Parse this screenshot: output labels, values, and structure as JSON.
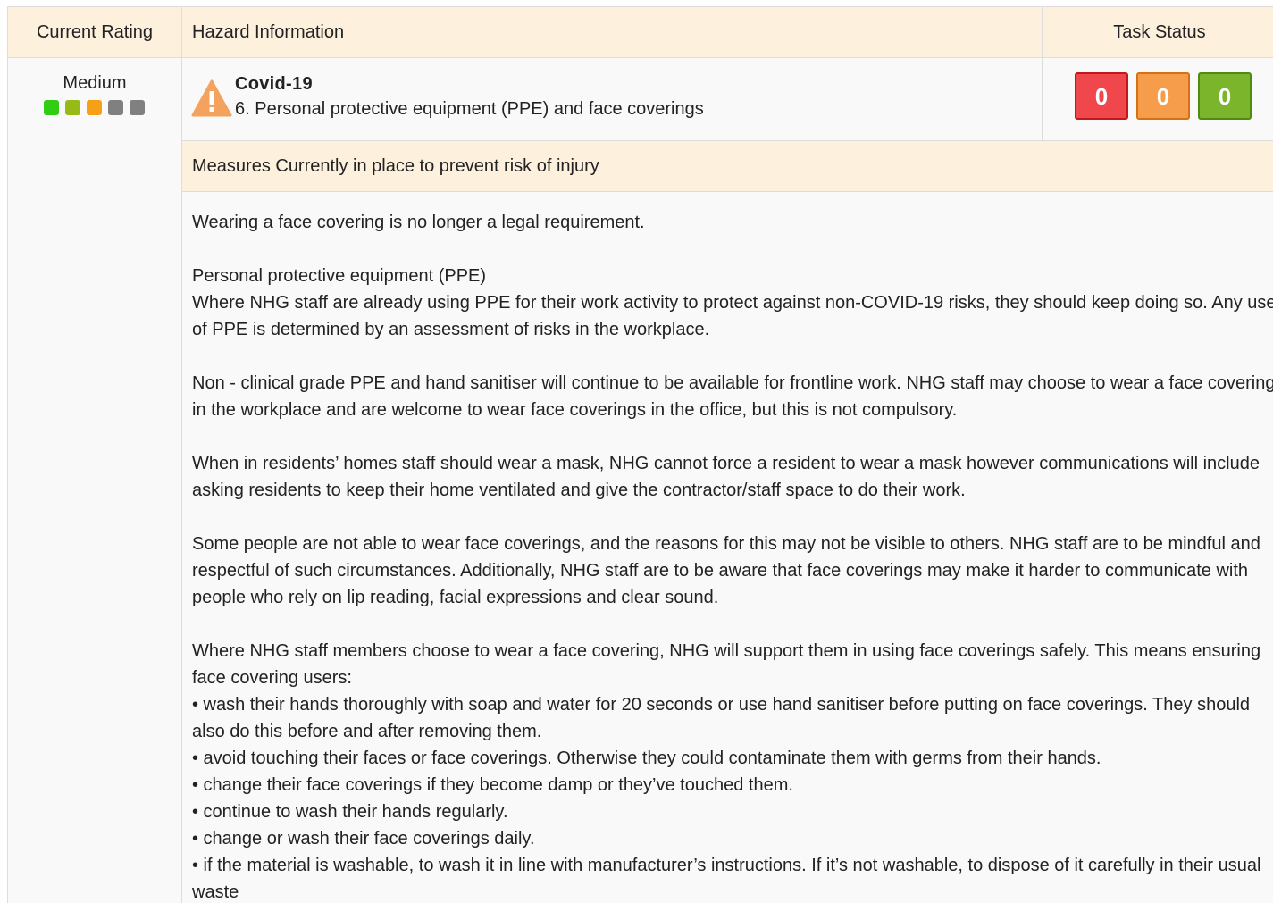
{
  "table": {
    "headers": {
      "current_rating": "Current Rating",
      "hazard_information": "Hazard Information",
      "task_status": "Task Status"
    }
  },
  "rating": {
    "label": "Medium",
    "dots": [
      {
        "color": "#33cc14"
      },
      {
        "color": "#96bb16"
      },
      {
        "color": "#f5a017"
      },
      {
        "color": "#808080"
      },
      {
        "color": "#808080"
      }
    ]
  },
  "hazard": {
    "icon": "warning-triangle-icon",
    "title": "Covid-19",
    "subtitle": "6. Personal protective equipment (PPE) and face coverings"
  },
  "task_status": {
    "red_count": "0",
    "orange_count": "0",
    "green_count": "0",
    "colors": {
      "red": "#f0474c",
      "orange": "#f59d4a",
      "green": "#7ab52b"
    }
  },
  "measures": {
    "heading": "Measures Currently in place to prevent risk of injury",
    "p1": "Wearing a face covering is no longer a legal requirement.",
    "p2_title": "Personal protective equipment (PPE)",
    "p2_body": "Where NHG staff are already using PPE for their work activity to protect against non-COVID-19 risks, they should keep doing so. Any use of PPE is determined by an assessment of risks in the workplace.",
    "p3": "Non - clinical grade PPE and hand sanitiser will continue to be available for frontline work. NHG staff may choose to wear a face covering in the workplace and are welcome to wear face coverings in the office, but this is not compulsory.",
    "p4": "When in residents’ homes staff should wear a mask, NHG cannot force a resident to wear a mask however communications will include asking residents to keep their home ventilated and give the contractor/staff space to do their work.",
    "p5": "Some people are not able to wear face coverings, and the reasons for this may not be visible to others. NHG staff are to be mindful and respectful of such circumstances. Additionally, NHG staff are to be aware that face coverings may make it harder to communicate with people who rely on lip reading, facial expressions and clear sound.",
    "p6_intro": "Where NHG staff members choose to wear a face covering, NHG will support them in using face coverings safely. This means ensuring face covering users:",
    "bullets": [
      "• wash their hands thoroughly with soap and water for 20 seconds or use hand sanitiser before putting on face coverings. They should also do this before and after removing them.",
      "• avoid touching their faces or face coverings. Otherwise they could contaminate them with germs from their hands.",
      "• change their face coverings if they become damp or they’ve touched them.",
      "• continue to wash their hands regularly.",
      "• change or wash their face coverings daily.",
      "• if the material is washable, to wash it in line with manufacturer’s instructions. If it’s not washable, to dispose of it carefully in their usual waste"
    ]
  }
}
